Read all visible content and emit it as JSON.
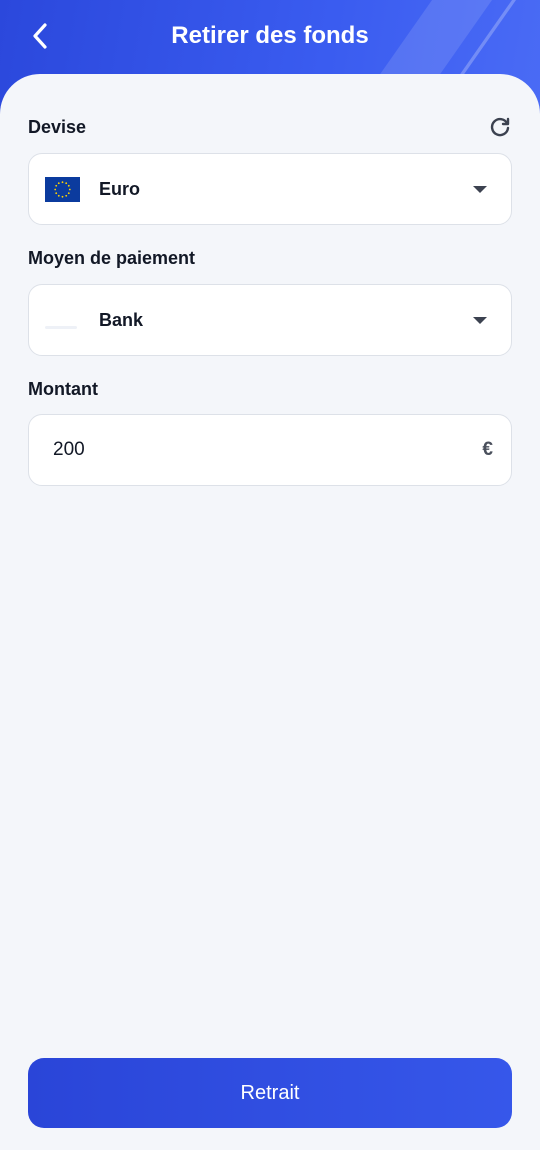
{
  "header": {
    "title": "Retirer des fonds",
    "back_icon": "chevron-left-icon",
    "color": "#3352e6"
  },
  "currency": {
    "label": "Devise",
    "refresh_icon": "refresh-icon",
    "flag_icon": "eu-flag-icon",
    "selected": "Euro",
    "dropdown_icon": "caret-down-icon"
  },
  "payment_method": {
    "label": "Moyen de paiement",
    "selected": "Bank",
    "dropdown_icon": "caret-down-icon"
  },
  "amount": {
    "label": "Montant",
    "value": "200",
    "currency_symbol": "€"
  },
  "submit": {
    "label": "Retrait",
    "color": "#2f4fe3"
  }
}
